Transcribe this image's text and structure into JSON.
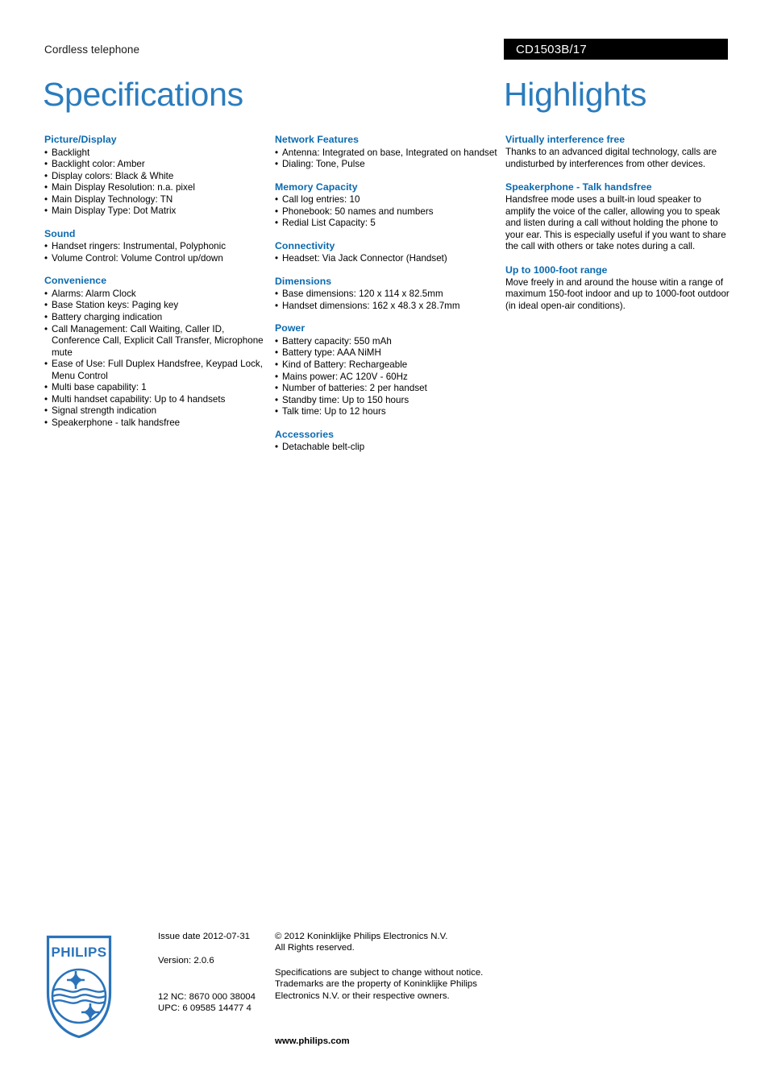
{
  "header": {
    "category": "Cordless telephone",
    "product_code": "CD1503B/17"
  },
  "titles": {
    "specifications": "Specifications",
    "highlights": "Highlights"
  },
  "colors": {
    "title_blue": "#2b7cbd",
    "heading_blue": "#0b6ab0",
    "code_bar_bg": "#000000",
    "logo_blue": "#2a73bb"
  },
  "bullet": "•",
  "spec_columns": [
    {
      "sections": [
        {
          "heading": "Picture/Display",
          "items": [
            "Backlight",
            "Backlight color: Amber",
            "Display colors: Black & White",
            "Main Display Resolution: n.a. pixel",
            "Main Display Technology: TN",
            "Main Display Type: Dot Matrix"
          ]
        },
        {
          "heading": "Sound",
          "items": [
            "Handset ringers: Instrumental, Polyphonic",
            "Volume Control: Volume Control up/down"
          ]
        },
        {
          "heading": "Convenience",
          "items": [
            "Alarms: Alarm Clock",
            "Base Station keys: Paging key",
            "Battery charging indication",
            "Call Management: Call Waiting, Caller ID, Conference Call, Explicit Call Transfer, Microphone mute",
            "Ease of Use: Full Duplex Handsfree, Keypad Lock, Menu Control",
            "Multi base capability: 1",
            "Multi handset capability: Up to 4 handsets",
            "Signal strength indication",
            "Speakerphone - talk handsfree"
          ]
        }
      ]
    },
    {
      "sections": [
        {
          "heading": "Network Features",
          "items": [
            "Antenna: Integrated on base, Integrated on handset",
            "Dialing: Tone, Pulse"
          ]
        },
        {
          "heading": "Memory Capacity",
          "items": [
            "Call log entries: 10",
            "Phonebook: 50 names and numbers",
            "Redial List Capacity: 5"
          ]
        },
        {
          "heading": "Connectivity",
          "items": [
            "Headset: Via Jack Connector (Handset)"
          ]
        },
        {
          "heading": "Dimensions",
          "items": [
            "Base dimensions: 120 x 114 x 82.5mm",
            "Handset dimensions: 162 x 48.3 x 28.7mm"
          ]
        },
        {
          "heading": "Power",
          "items": [
            "Battery capacity: 550 mAh",
            "Battery type: AAA NiMH",
            "Kind of Battery: Rechargeable",
            "Mains power: AC 120V - 60Hz",
            "Number of batteries: 2 per handset",
            "Standby time: Up to 150 hours",
            "Talk time: Up to 12 hours"
          ]
        },
        {
          "heading": "Accessories",
          "items": [
            "Detachable belt-clip"
          ]
        }
      ]
    }
  ],
  "highlights": [
    {
      "heading": "Virtually interference free",
      "body": "Thanks to an advanced digital technology, calls are undisturbed by interferences from other devices."
    },
    {
      "heading": "Speakerphone - Talk handsfree",
      "body": "Handsfree mode uses a built-in loud speaker to amplify the voice of the caller, allowing you to speak and listen during a call without holding the phone to your ear. This is especially useful if you want to share the call with others or take notes during a call."
    },
    {
      "heading": "Up to 1000-foot range",
      "body": "Move freely in and around the house witin a range of maximum 150-foot indoor and up to 1000-foot outdoor (in ideal open-air conditions)."
    }
  ],
  "footer": {
    "logo_wordmark": "PHILIPS",
    "issue_date": "Issue date 2012-07-31",
    "version": "Version: 2.0.6",
    "nc_code": "12 NC: 8670 000 38004",
    "upc_code": "UPC: 6 09585 14477 4",
    "copyright_line1": "© 2012 Koninklijke Philips Electronics N.V.",
    "copyright_line2": "All Rights reserved.",
    "disclaimer_line1": "Specifications are subject to change without notice.",
    "disclaimer_line2": "Trademarks are the property of Koninklijke Philips",
    "disclaimer_line3": "Electronics N.V. or their respective owners.",
    "website": "www.philips.com"
  }
}
